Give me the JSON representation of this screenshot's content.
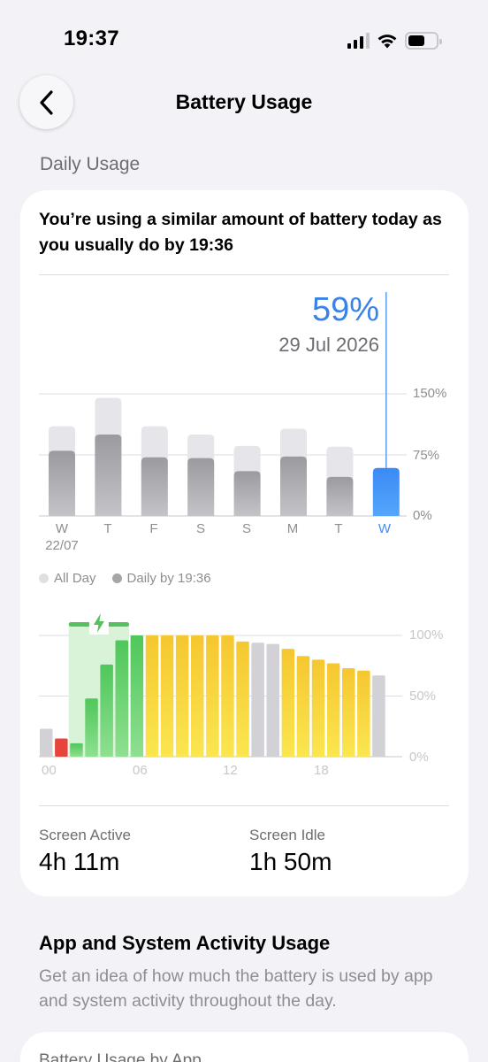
{
  "status_bar": {
    "time": "19:37",
    "icons": [
      "cellular-signal-icon",
      "wifi-icon",
      "battery-icon"
    ]
  },
  "nav": {
    "back_icon": "chevron-left-icon",
    "title": "Battery Usage"
  },
  "daily_usage": {
    "section_title": "Daily Usage",
    "summary": "You’re using a similar amount of battery today as you usually do by 19:36",
    "selected": {
      "value": "59%",
      "date": "29 Jul 2026"
    },
    "legend": [
      "All Day",
      "Daily by 19:36"
    ],
    "colors": {
      "all_day": "#e5e5ea",
      "by_time": "#aeaeb2",
      "selected": "#3d8ff5",
      "line": "#5b9cf0"
    }
  },
  "chart_data": [
    {
      "type": "bar",
      "categories": [
        "W",
        "T",
        "F",
        "S",
        "S",
        "M",
        "T",
        "W"
      ],
      "x_sublabels": [
        "22/07",
        "",
        "",
        "",
        "",
        "",
        "",
        ""
      ],
      "series": [
        {
          "name": "All Day",
          "values": [
            110,
            145,
            110,
            100,
            86,
            107,
            85,
            null
          ]
        },
        {
          "name": "Daily by 19:36",
          "values": [
            80,
            100,
            72,
            71,
            55,
            73,
            48,
            59
          ]
        }
      ],
      "y_ticks": [
        "0%",
        "75%",
        "150%"
      ],
      "ylim": [
        0,
        150
      ],
      "selected_index": 7,
      "grid": true
    },
    {
      "type": "bar",
      "x_ticks": [
        "00",
        "06",
        "12",
        "18"
      ],
      "y_ticks": [
        "0%",
        "50%",
        "100%"
      ],
      "ylim": [
        0,
        100
      ],
      "charging_window": {
        "start_hour": 2,
        "end_hour": 6
      },
      "levels": [
        23,
        15,
        11,
        48,
        76,
        96,
        100,
        100,
        100,
        100,
        100,
        100,
        100,
        95,
        94,
        93,
        89,
        83,
        80,
        77,
        73,
        71,
        67
      ],
      "states": [
        "idle",
        "low",
        "charging",
        "charging",
        "charging",
        "charging",
        "charging",
        "active",
        "active",
        "active",
        "active",
        "active",
        "active",
        "active",
        "idle",
        "idle",
        "active",
        "active",
        "active",
        "active",
        "active",
        "active",
        "idle"
      ],
      "colors": {
        "idle": "#d1d1d6",
        "low": "#e5453a",
        "charging": "#5fd068",
        "active": "#f7d33a",
        "charge_band": "#d9f3d9",
        "charge_bar": "#56c05f"
      }
    }
  ],
  "stats": [
    {
      "label": "Screen Active",
      "value": "4h 11m"
    },
    {
      "label": "Screen Idle",
      "value": "1h 50m"
    }
  ],
  "app_activity": {
    "title": "App and System Activity Usage",
    "description": "Get an idea of how much the battery is used by app and system activity throughout the day.",
    "card_title": "Battery Usage by App"
  }
}
